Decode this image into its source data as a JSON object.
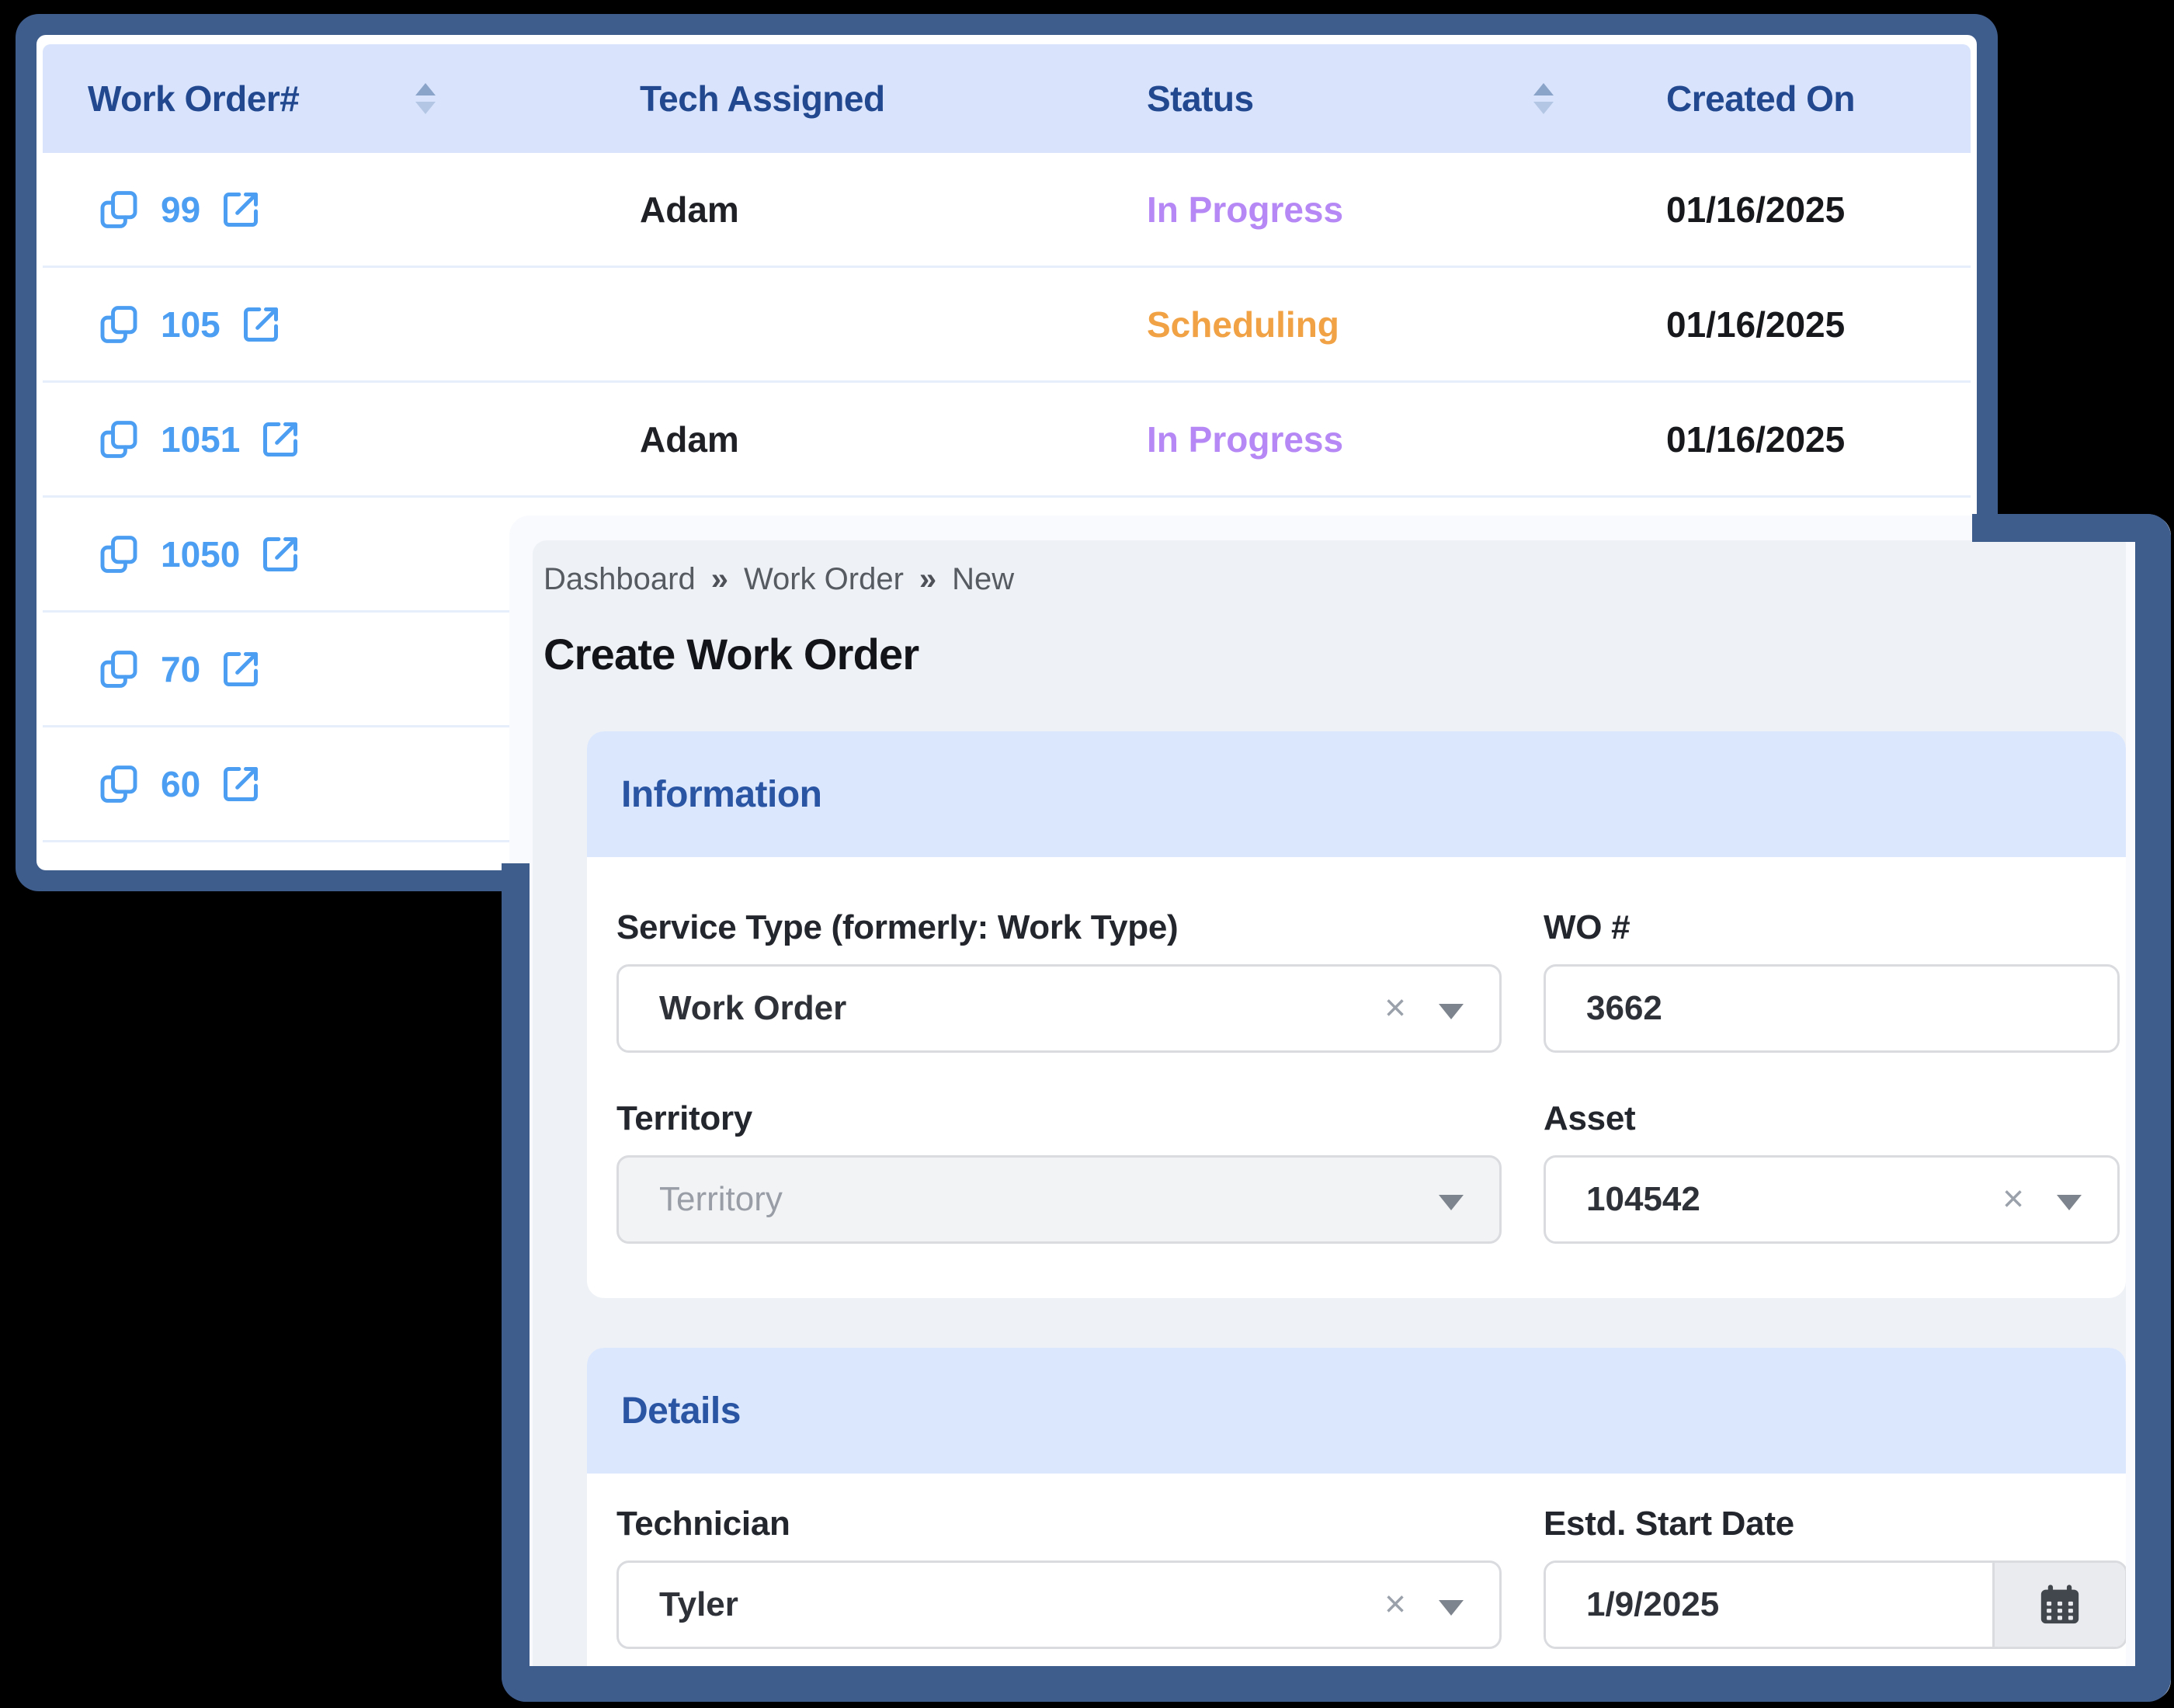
{
  "table": {
    "columns": [
      {
        "label": "Work Order#",
        "sortable": true
      },
      {
        "label": "Tech Assigned",
        "sortable": false
      },
      {
        "label": "Status",
        "sortable": true
      },
      {
        "label": "Created On",
        "sortable": false
      }
    ],
    "rows": [
      {
        "id": "99",
        "tech": "Adam",
        "status": "In Progress",
        "status_color": "#b588f5",
        "created": "01/16/2025"
      },
      {
        "id": "105",
        "tech": "",
        "status": "Scheduling",
        "status_color": "#f0a245",
        "created": "01/16/2025"
      },
      {
        "id": "1051",
        "tech": "Adam",
        "status": "In Progress",
        "status_color": "#b588f5",
        "created": "01/16/2025"
      },
      {
        "id": "1050",
        "tech": "",
        "status": "",
        "status_color": "",
        "created": ""
      },
      {
        "id": "70",
        "tech": "",
        "status": "",
        "status_color": "",
        "created": ""
      },
      {
        "id": "60",
        "tech": "",
        "status": "",
        "status_color": "",
        "created": ""
      }
    ]
  },
  "form": {
    "breadcrumb": {
      "items": [
        "Dashboard",
        "Work Order",
        "New"
      ],
      "separator": "»"
    },
    "title": "Create Work Order",
    "info": {
      "heading": "Information",
      "service_type": {
        "label": "Service Type (formerly: Work Type)",
        "value": "Work Order"
      },
      "wo_number": {
        "label": "WO #",
        "value": "3662"
      },
      "territory": {
        "label": "Territory",
        "placeholder": "Territory"
      },
      "asset": {
        "label": "Asset",
        "value": "104542"
      }
    },
    "details": {
      "heading": "Details",
      "technician": {
        "label": "Technician",
        "value": "Tyler"
      },
      "start_date": {
        "label": "Estd. Start Date",
        "value": "1/9/2025"
      }
    }
  },
  "icons": {
    "clear": "×"
  },
  "colors": {
    "panel_border": "#3e5c8c",
    "accent_blue": "#4c9ef2",
    "status_in_progress": "#b588f5",
    "status_scheduling": "#f0a245",
    "header_bg": "#d9e4fc",
    "section_band_bg": "#dbe7fc"
  }
}
